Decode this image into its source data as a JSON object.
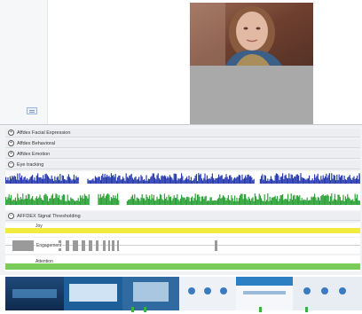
{
  "sections": {
    "facial": "Affdex Facial Expression",
    "behavioral": "Affdex Behavioral",
    "emotion": "Affdex Emotion",
    "eye": "Eye tracking",
    "signal": "AFFDEX Signal Thresholding"
  },
  "tracks": {
    "joy": "Joy",
    "engagement": "Engagement",
    "attention": "Attention"
  },
  "icons": {
    "expand": "plus-circle-icon"
  },
  "colors": {
    "blue": "#2c3fb0",
    "green": "#2fa23a",
    "yellow": "#f0eb3c",
    "lightgreen": "#7acc5a",
    "gray": "#9a9a9a"
  }
}
